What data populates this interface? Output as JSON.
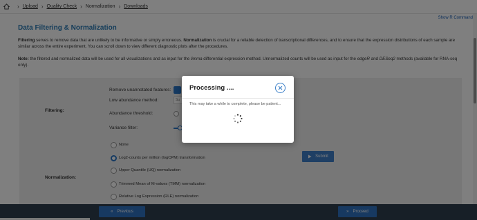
{
  "breadcrumb": {
    "items": [
      {
        "label": "Upload",
        "link": true
      },
      {
        "label": "Quality Check",
        "link": true
      },
      {
        "label": "Normalization",
        "link": false
      },
      {
        "label": "Downloads",
        "link": true
      }
    ]
  },
  "header": {
    "show_r_commands": "Show R Commands"
  },
  "page": {
    "title": "Data Filtering & Normalization",
    "para1_lead": "Filtering",
    "para1_a": " serves to remove data that are unlikely to be informative or simply erroneous. ",
    "para1_bold": "Normalization",
    "para1_b": " is crucial for a reliable detection of transcriptional differences, and to ensure that the expression distributions of each sample are similar across the entire experiment. You can scroll down to view different diagnostic plots after the procedures.",
    "para2_lead": "Note:",
    "para2_a": " the filtered and normalized data will be used for all visualizations and as input for the ",
    "para2_limma": "limma",
    "para2_b": " differential expression method. Unnormalized counts will be used as input for the ",
    "para2_edger": "edgeR",
    "para2_and": " and ",
    "para2_deseq": "DESeq2",
    "para2_c": " methods (available for RNA-seq only)."
  },
  "filtering": {
    "section_label": "Filtering:",
    "remove_unannotated": "Remove unannotated features:",
    "low_abundance_method": "Low abundance method:",
    "low_abundance_value": "Su",
    "abundance_threshold": "Abundance threshold:",
    "variance_filter": "Variance filter:"
  },
  "normalization": {
    "section_label": "Normalization:",
    "options": [
      {
        "label": "None",
        "selected": false
      },
      {
        "label": "Log2-counts per million (logCPM) transformation",
        "selected": true
      },
      {
        "label": "Upper Quantile (UQ) normalization",
        "selected": false
      },
      {
        "label": "Trimmed Mean of M-values (TMM) normalization",
        "selected": false
      },
      {
        "label": "Relative Log Expression (RLE) normalization",
        "selected": false
      }
    ],
    "submit_label": "Submit"
  },
  "footer": {
    "previous_label": "Previous",
    "proceed_label": "Proceed"
  },
  "modal": {
    "title": "Processing ....",
    "message": "This may take a while to complete, please be patient..."
  },
  "colors": {
    "accent": "#2a74c4",
    "title": "#2a7ab5",
    "bottom_bar": "#2f3e4f"
  }
}
